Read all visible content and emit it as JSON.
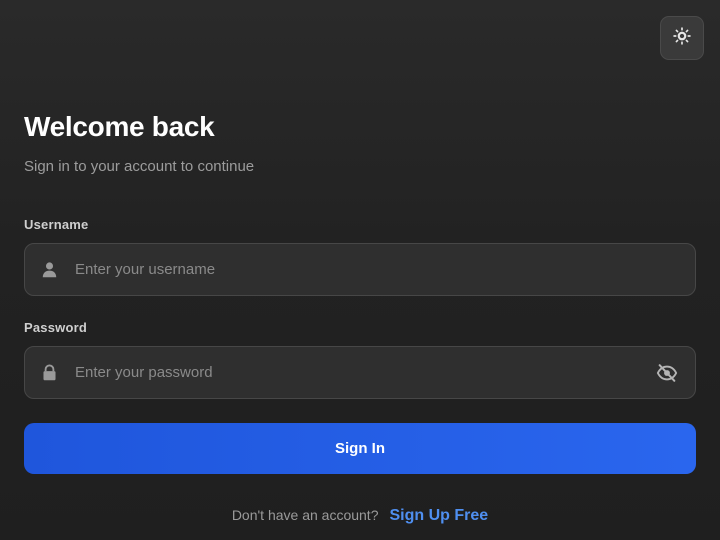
{
  "theme_toggle": {
    "icon": "sun-icon"
  },
  "header": {
    "title": "Welcome back",
    "subtitle": "Sign in to your account to continue"
  },
  "form": {
    "username": {
      "label": "Username",
      "placeholder": "Enter your username",
      "value": "",
      "icon": "user-icon"
    },
    "password": {
      "label": "Password",
      "placeholder": "Enter your password",
      "value": "",
      "icon": "lock-icon",
      "toggle_icon": "eye-off-icon"
    },
    "submit_label": "Sign In"
  },
  "footer": {
    "prompt": "Don't have an account?",
    "link": "Sign Up Free"
  },
  "colors": {
    "background": "#242424",
    "accent": "#2563eb",
    "link": "#4f8ff0"
  }
}
